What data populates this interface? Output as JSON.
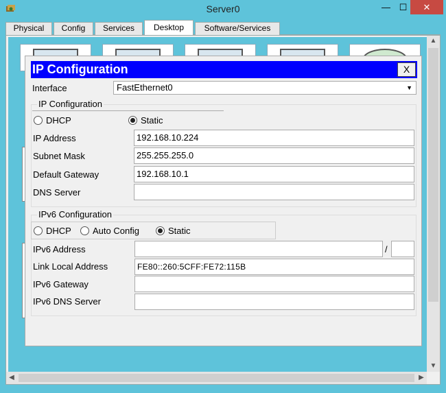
{
  "window": {
    "title": "Server0",
    "minimize_label": "—",
    "maximize_label": "☐",
    "close_label": "✕"
  },
  "tabs": [
    {
      "label": "Physical"
    },
    {
      "label": "Config"
    },
    {
      "label": "Services"
    },
    {
      "label": "Desktop"
    },
    {
      "label": "Software/Services"
    }
  ],
  "dialog": {
    "title": "IP Configuration",
    "close_label": "X",
    "interface_label": "Interface",
    "interface_value": "FastEthernet0",
    "ipv4": {
      "group_title": "IP Configuration",
      "dhcp_label": "DHCP",
      "static_label": "Static",
      "ip_address_label": "IP Address",
      "ip_address_value": "192.168.10.224",
      "subnet_mask_label": "Subnet Mask",
      "subnet_mask_value": "255.255.255.0",
      "default_gateway_label": "Default Gateway",
      "default_gateway_value": "192.168.10.1",
      "dns_server_label": "DNS Server",
      "dns_server_value": ""
    },
    "ipv6": {
      "group_title": "IPv6 Configuration",
      "dhcp_label": "DHCP",
      "auto_config_label": "Auto Config",
      "static_label": "Static",
      "ipv6_address_label": "IPv6 Address",
      "ipv6_address_value": "",
      "prefix_separator": "/",
      "prefix_value": "",
      "link_local_label": "Link Local Address",
      "link_local_value": "FE80::260:5CFF:FE72:115B",
      "ipv6_gateway_label": "IPv6 Gateway",
      "ipv6_gateway_value": "",
      "ipv6_dns_label": "IPv6 DNS Server",
      "ipv6_dns_value": ""
    }
  },
  "colors": {
    "titlebar": "#5ec3da",
    "dialog_title_bg": "#0000ff",
    "close_button": "#c74a42"
  }
}
